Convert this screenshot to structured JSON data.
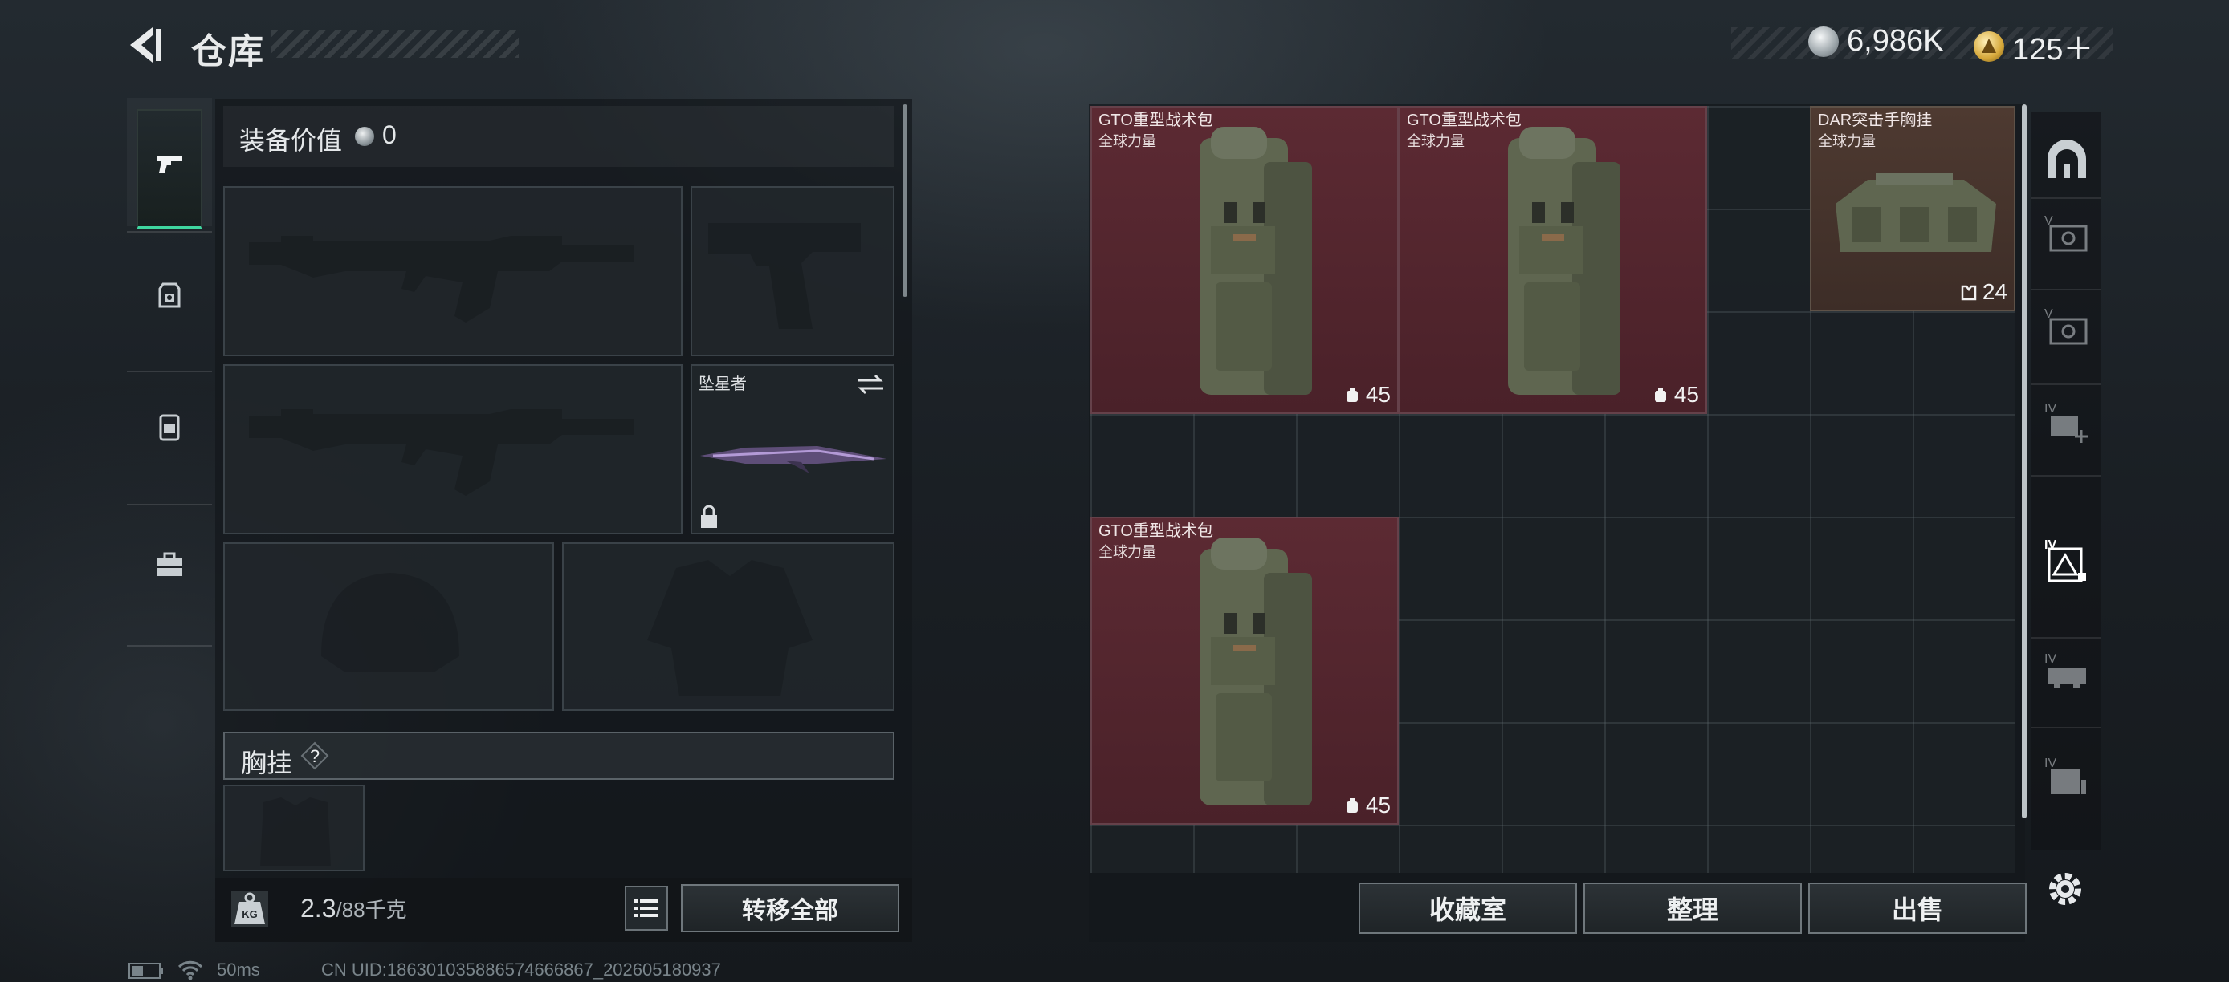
{
  "header": {
    "title": "仓库",
    "currency_silver": "6,986K",
    "currency_gold": "125＋"
  },
  "left_nav": {
    "items": [
      {
        "icon": "pistol-icon",
        "active": true
      },
      {
        "icon": "helmet-armor-icon",
        "active": false
      },
      {
        "icon": "backpack-icon",
        "active": false
      },
      {
        "icon": "briefcase-icon",
        "active": false
      }
    ]
  },
  "equipment": {
    "value_label": "装备价值",
    "value": "0",
    "melee_slot_name": "坠星者",
    "chest_rig_section": "胸挂",
    "help_symbol": "?"
  },
  "weight": {
    "current": "2.3",
    "capacity": "/88千克",
    "badge": "KG"
  },
  "buttons": {
    "transfer_all": "转移全部",
    "collection": "收藏室",
    "organize": "整理",
    "sell": "出售"
  },
  "storage_items": [
    {
      "name": "GTO重型战术包",
      "sub": "全球力量",
      "capacity": "45",
      "kind": "backpack"
    },
    {
      "name": "GTO重型战术包",
      "sub": "全球力量",
      "capacity": "45",
      "kind": "backpack"
    },
    {
      "name": "DAR突击手胸挂",
      "sub": "全球力量",
      "capacity": "24",
      "kind": "chest-rig"
    },
    {
      "name": "GTO重型战术包",
      "sub": "全球力量",
      "capacity": "45",
      "kind": "backpack"
    }
  ],
  "side_tabs": [
    {
      "icon": "storage-dome-icon",
      "tier": ""
    },
    {
      "icon": "tier-v-backpack-filter-icon",
      "tier": "V"
    },
    {
      "icon": "tier-v-backpack-filter-icon-2",
      "tier": "V"
    },
    {
      "icon": "tier-iv-add-icon",
      "tier": "IV"
    },
    {
      "icon": "tier-iv-triangle-icon",
      "tier": "IV"
    },
    {
      "icon": "tier-iv-vehicle-icon",
      "tier": "IV"
    },
    {
      "icon": "tier-iv-box-icon",
      "tier": "IV"
    }
  ],
  "status_bar": {
    "ping": "50ms",
    "uid": "CN UID:186301035886574666867_202605180937"
  },
  "colors": {
    "item_backpack_bg": "#5c2a33",
    "item_chest_bg": "#4e3a31",
    "active_tab_accent": "#3fd6a0"
  }
}
